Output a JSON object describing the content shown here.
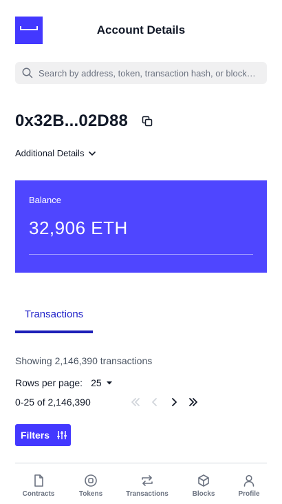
{
  "header": {
    "title": "Account Details"
  },
  "search": {
    "placeholder": "Search by address, token, transaction hash, or block n..."
  },
  "account": {
    "address": "0x32B...02D88",
    "details_label": "Additional Details"
  },
  "balance": {
    "label": "Balance",
    "amount": "32,906 ETH"
  },
  "tabs": [
    {
      "label": "Transactions",
      "active": true
    }
  ],
  "transactions": {
    "showing": "Showing 2,146,390 transactions",
    "rows_per_page_label": "Rows per page:",
    "rows_per_page_value": "25",
    "range": "0-25 of 2,146,390",
    "filters_label": "Filters"
  },
  "bottom_nav": [
    {
      "label": "Contracts",
      "icon": "file-icon"
    },
    {
      "label": "Tokens",
      "icon": "coin-icon"
    },
    {
      "label": "Transactions",
      "icon": "swap-icon"
    },
    {
      "label": "Blocks",
      "icon": "cube-icon"
    },
    {
      "label": "Profile",
      "icon": "user-icon"
    }
  ],
  "colors": {
    "accent": "#4338ff",
    "balance_card": "#4f46ff",
    "tab_active": "#1e20c8"
  }
}
